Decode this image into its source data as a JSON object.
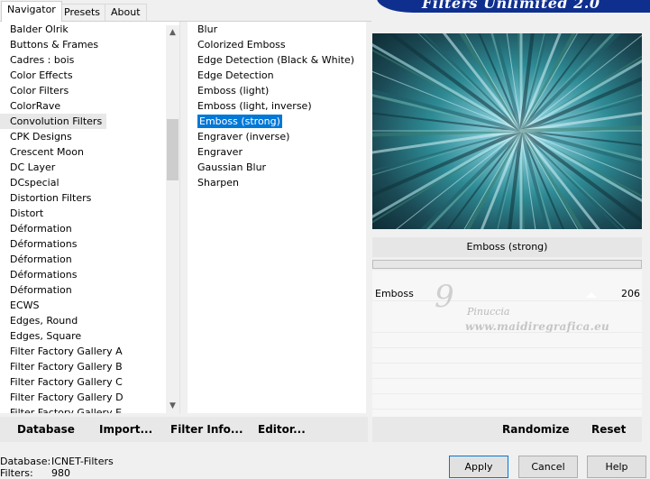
{
  "banner": {
    "title": "Filters Unlimited 2.0"
  },
  "tabs": [
    {
      "label": "Navigator",
      "active": true
    },
    {
      "label": "Presets",
      "active": false
    },
    {
      "label": "About",
      "active": false
    }
  ],
  "categories": [
    "Balder Olrik",
    "Buttons & Frames",
    "Cadres : bois",
    "Color Effects",
    "Color Filters",
    "ColorRave",
    "Convolution Filters",
    "CPK Designs",
    "Crescent Moon",
    "DC Layer",
    "DCspecial",
    "Distortion Filters",
    "Distort",
    "Déformation",
    "Déformations",
    "Déformation",
    "Déformations",
    "Déformation",
    "ECWS",
    "Edges, Round",
    "Edges, Square",
    "Filter Factory Gallery A",
    "Filter Factory Gallery B",
    "Filter Factory Gallery C",
    "Filter Factory Gallery D",
    "Filter Factory Gallery E"
  ],
  "selected_category_index": 6,
  "filters": [
    "Blur",
    "Colorized Emboss",
    "Edge Detection (Black & White)",
    "Edge Detection",
    "Emboss (light)",
    "Emboss (light, inverse)",
    "Emboss (strong)",
    "Engraver (inverse)",
    "Engraver",
    "Gaussian Blur",
    "Sharpen"
  ],
  "selected_filter_index": 6,
  "filter_name": "Emboss (strong)",
  "parameter": {
    "label": "Emboss",
    "value": "206",
    "level": 0.81
  },
  "watermark": {
    "mark": "9",
    "line1": "Pinuccia",
    "line2": "www.maidiregrafica.eu"
  },
  "toolbar": {
    "database": "Database",
    "import": "Import...",
    "filter_info": "Filter Info...",
    "editor": "Editor...",
    "randomize": "Randomize",
    "reset": "Reset"
  },
  "status": {
    "database_label": "Database:",
    "database_value": "ICNET-Filters",
    "filters_label": "Filters:",
    "filters_value": "980"
  },
  "buttons": {
    "apply": "Apply",
    "cancel": "Cancel",
    "help": "Help"
  },
  "colors": {
    "banner": "#0f2f8f",
    "selection": "#0078d7"
  }
}
